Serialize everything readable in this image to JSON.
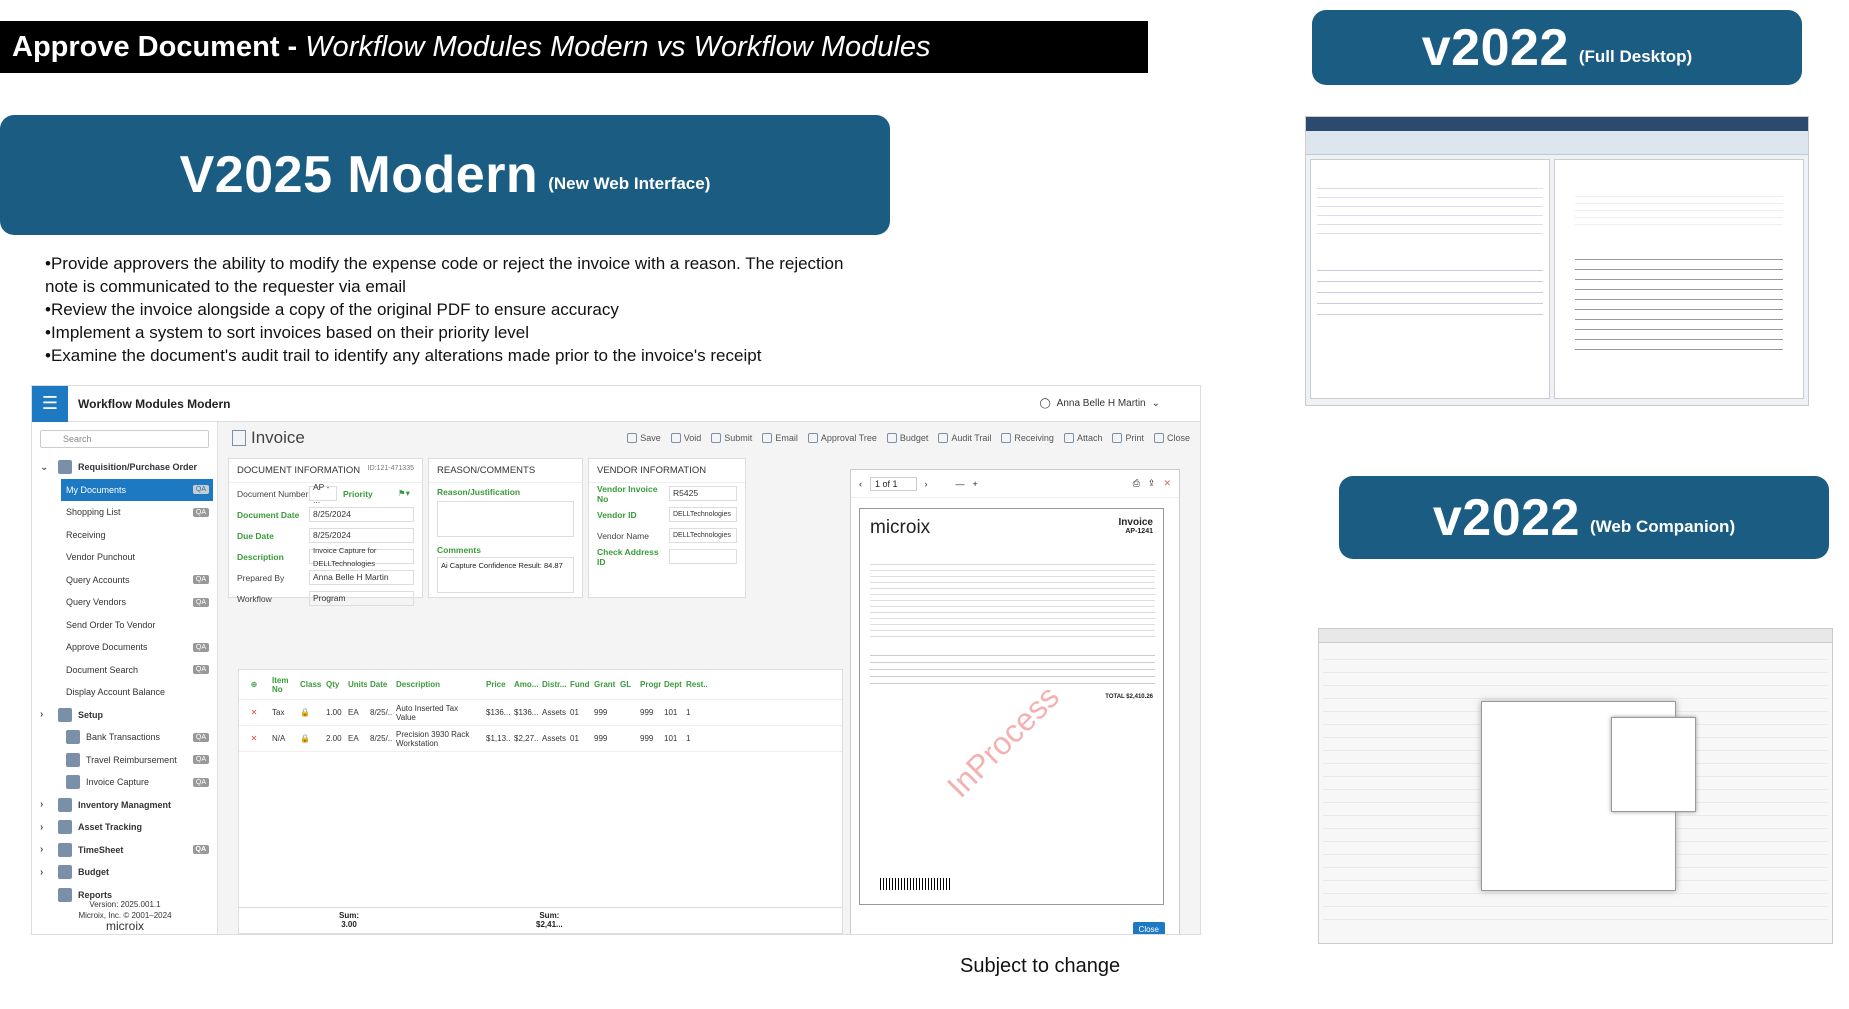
{
  "header": {
    "bold": "Approve Document -",
    "italic": "Workflow Modules Modern vs Workflow Modules"
  },
  "v2025": {
    "title": "V2025 Modern",
    "sub": "(New Web Interface)"
  },
  "v2022a": {
    "title": "v2022",
    "sub": "(Full Desktop)"
  },
  "v2022b": {
    "title": "v2022",
    "sub": "(Web Companion)"
  },
  "bullets": [
    "•Provide approvers the ability to modify the expense code or reject the invoice with a reason. The rejection note is communicated to the requester via email",
    "•Review the invoice alongside a copy of the original PDF to ensure accuracy",
    "•Implement a system to sort invoices based on their priority level",
    "•Examine the document's audit trail to identify any alterations made prior to the invoice's receipt"
  ],
  "app": {
    "title": "Workflow Modules Modern",
    "user": "Anna Belle H Martin",
    "search": "Search",
    "version": "Version: 2025.001.1",
    "copyright": "Microix, Inc. © 2001–2024",
    "brand": "microix"
  },
  "nav": [
    {
      "label": "Requisition/Purchase Order",
      "type": "grp",
      "chev": "v"
    },
    {
      "label": "My Documents",
      "type": "sel",
      "qa": "QA"
    },
    {
      "label": "Shopping List",
      "qa": "QA"
    },
    {
      "label": "Receiving"
    },
    {
      "label": "Vendor Punchout"
    },
    {
      "label": "Query Accounts",
      "qa": "QA"
    },
    {
      "label": "Query Vendors",
      "qa": "QA"
    },
    {
      "label": "Send Order To Vendor"
    },
    {
      "label": "Approve Documents",
      "qa": "QA"
    },
    {
      "label": "Document Search",
      "qa": "QA"
    },
    {
      "label": "Display Account Balance"
    },
    {
      "label": "Setup",
      "type": "grp",
      "chev": ">"
    },
    {
      "label": "Bank Transactions",
      "qa": "QA",
      "icon": true
    },
    {
      "label": "Travel Reimbursement",
      "qa": "QA",
      "icon": true
    },
    {
      "label": "Invoice Capture",
      "qa": "QA",
      "icon": true
    },
    {
      "label": "Inventory Managment",
      "type": "grp",
      "chev": ">"
    },
    {
      "label": "Asset Tracking",
      "type": "grp",
      "chev": ">"
    },
    {
      "label": "TimeSheet",
      "type": "grp",
      "chev": ">",
      "qa": "QA"
    },
    {
      "label": "Budget",
      "type": "grp",
      "chev": ">"
    },
    {
      "label": "Reports",
      "type": "grp"
    }
  ],
  "toolbar": {
    "title": "Invoice",
    "buttons": [
      "Save",
      "Void",
      "Submit",
      "Email",
      "Approval Tree",
      "Budget",
      "Audit Trail",
      "Receiving",
      "Attach",
      "Print",
      "Close"
    ]
  },
  "docinfo": {
    "title": "DOCUMENT INFORMATION",
    "id": "ID:121-471335",
    "doc_number_label": "Document Number",
    "doc_number": "AP - ...",
    "priority_label": "Priority",
    "doc_date_label": "Document Date",
    "doc_date": "8/25/2024",
    "due_date_label": "Due Date",
    "due_date": "8/25/2024",
    "desc_label": "Description",
    "desc": "Invoice Capture for DELLTechnologies",
    "prep_label": "Prepared By",
    "prep": "Anna Belle H Martin",
    "wf_label": "Workflow",
    "wf": "Program"
  },
  "reason": {
    "title": "REASON/COMMENTS",
    "just_label": "Reason/Justification",
    "comments_label": "Comments",
    "comments": "Ai Capture Confidence Result: 84.87"
  },
  "vendor": {
    "title": "VENDOR INFORMATION",
    "vin_label": "Vendor Invoice No",
    "vin": "R5425",
    "vid_label": "Vendor ID",
    "vid": "DELLTechnologies",
    "vname_label": "Vendor Name",
    "vname": "DELLTechnologies",
    "chk_label": "Check Address ID"
  },
  "grid": {
    "headers": [
      "Item No",
      "Class",
      "Qty",
      "Units",
      "Date",
      "Description",
      "Price",
      "Amo...",
      "Distr...",
      "Fund",
      "Grant",
      "GL",
      "Progr",
      "Dept",
      "Rest..."
    ],
    "rows": [
      [
        "Tax",
        "1.00",
        "EA",
        "8/25/...",
        "Auto Inserted Tax Value",
        "$136....",
        "$136....",
        "Assets",
        "01",
        "999",
        "",
        "999",
        "101",
        "1"
      ],
      [
        "N/A",
        "2.00",
        "EA",
        "8/25/...",
        "Precision 3930 Rack Workstation",
        "$1,13...",
        "$2,27...",
        "Assets",
        "01",
        "999",
        "",
        "999",
        "101",
        "1"
      ]
    ],
    "sum_qty_label": "Sum:",
    "sum_qty": "3.00",
    "sum_amt_label": "Sum:",
    "sum_amt": "$2,41..."
  },
  "pdf": {
    "page": "1 of 1",
    "brand": "microix",
    "inv_title": "Invoice",
    "inv_no": "AP-1241",
    "watermark": "InProcess",
    "close": "Close",
    "total_label": "TOTAL",
    "total": "$2,410.26"
  },
  "note": "Subject to change"
}
